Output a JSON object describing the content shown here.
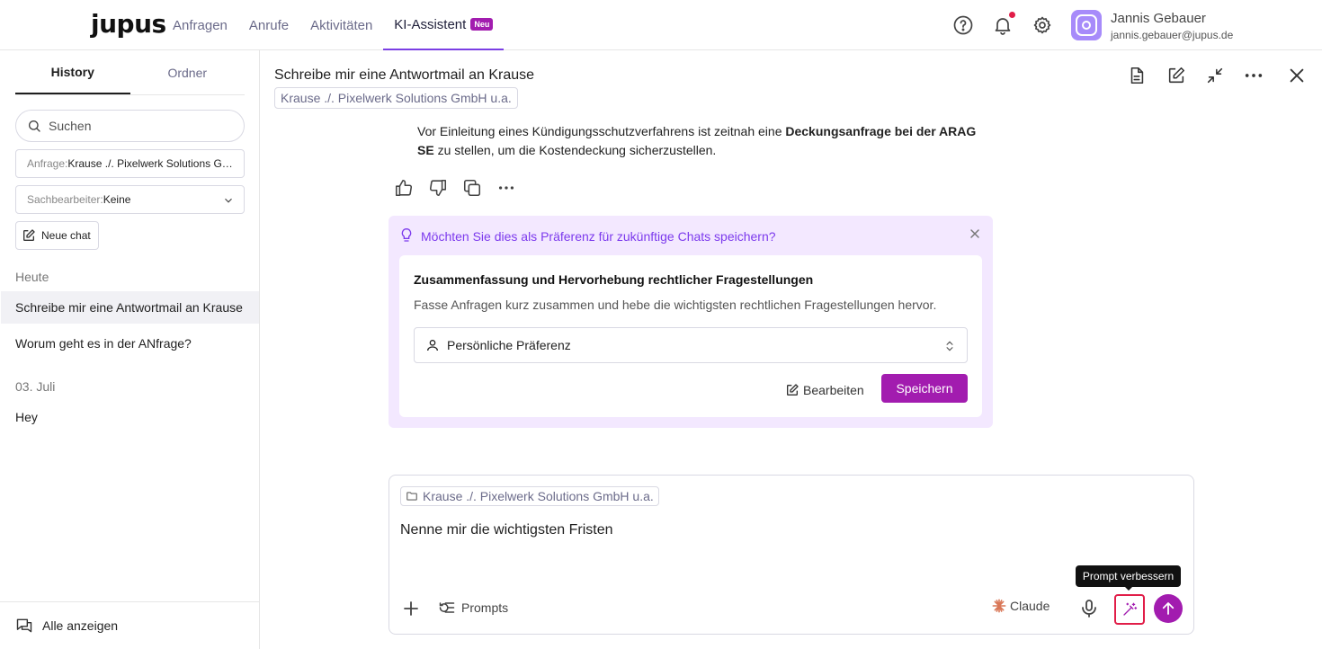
{
  "app": {
    "logo": "jupus"
  },
  "nav": {
    "items": [
      "Anfragen",
      "Anrufe",
      "Aktivitäten",
      "KI-Assistent"
    ],
    "new_badge": "Neu"
  },
  "user": {
    "name": "Jannis Gebauer",
    "email": "jannis.gebauer@jupus.de"
  },
  "sidebar": {
    "tabs": [
      "History",
      "Ordner"
    ],
    "search_placeholder": "Suchen",
    "filter_request": {
      "label": "Anfrage:",
      "value": "Krause ./. Pixelwerk Solutions GmbH u.a."
    },
    "filter_clerk": {
      "label": "Sachbearbeiter:",
      "value": "Keine"
    },
    "new_chat": "Neue chat",
    "groups": [
      {
        "label": "Heute",
        "chats": [
          "Schreibe mir eine Antwortmail an Krause",
          "Worum geht es in der ANfrage?"
        ]
      },
      {
        "label": "03. Juli",
        "chats": [
          "Hey"
        ]
      }
    ],
    "show_all": "Alle anzeigen"
  },
  "chat": {
    "title": "Schreibe mir eine Antwortmail an Krause",
    "case_tag": "Krause ./. Pixelwerk Solutions GmbH u.a.",
    "message": {
      "part1": "Vor Einleitung eines Kündigungsschutzverfahrens ist zeitnah eine ",
      "bold": "Deckungsanfrage bei der ARAG SE",
      "part2": " zu stellen, um die Kostendeckung sicherzustellen."
    }
  },
  "preference": {
    "question": "Möchten Sie dies als Präferenz für zukünftige Chats speichern?",
    "title": "Zusammenfassung und Hervorhebung rechtlicher Fragestellungen",
    "description": "Fasse Anfragen kurz zusammen und hebe die wichtigsten rechtlichen Fragestellungen hervor.",
    "scope": "Persönliche Präferenz",
    "edit_label": "Bearbeiten",
    "save_label": "Speichern"
  },
  "composer": {
    "case_tag": "Krause ./. Pixelwerk Solutions GmbH u.a.",
    "text": "Nenne mir die wichtigsten Fristen",
    "prompts_label": "Prompts",
    "model": "Claude",
    "tooltip": "Prompt verbessern"
  },
  "colors": {
    "accent": "#a21caf",
    "accent_light": "#f3e8ff",
    "link_purple": "#7c3aed"
  }
}
